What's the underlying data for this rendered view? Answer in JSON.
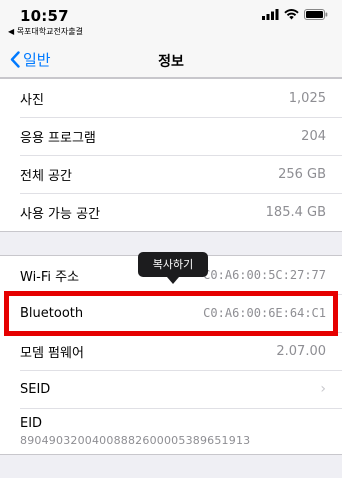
{
  "status": {
    "time": "10:57",
    "back_app": "◀ 목포대학교전자출결"
  },
  "nav": {
    "back_label": "일반",
    "title": "정보"
  },
  "group1": [
    {
      "label": "사진",
      "value": "1,025"
    },
    {
      "label": "응용 프로그램",
      "value": "204"
    },
    {
      "label": "전체 공간",
      "value": "256 GB"
    },
    {
      "label": "사용 가능 공간",
      "value": "185.4 GB"
    }
  ],
  "group2": {
    "wifi": {
      "label": "Wi-Fi 주소",
      "value": "C0:A6:00:5C:27:77"
    },
    "bluetooth": {
      "label": "Bluetooth",
      "value": "C0:A6:00:6E:64:C1"
    },
    "modem": {
      "label": "모뎀 펌웨어",
      "value": "2.07.00"
    },
    "seid": {
      "label": "SEID"
    },
    "eid": {
      "label": "EID",
      "value": "89049032004008882600005389651913"
    }
  },
  "tooltip": {
    "label": "복사하기"
  },
  "colors": {
    "accent": "#007aff",
    "highlight": "#e60000"
  }
}
